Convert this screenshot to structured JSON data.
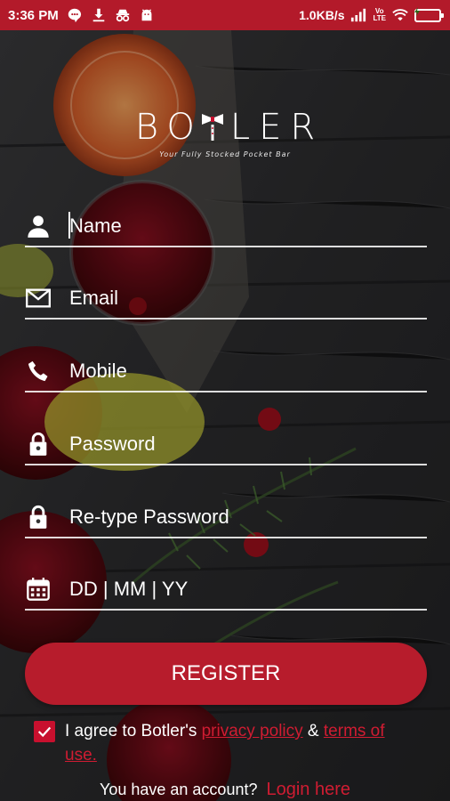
{
  "status_bar": {
    "time": "3:36 PM",
    "net_speed": "1.0KB/s",
    "volte_top": "Vo",
    "volte_bottom": "LTE",
    "left_icons": [
      "chat-bubble-icon",
      "download-icon",
      "incognito-icon",
      "android-icon"
    ],
    "right_icons": [
      "signal-icon",
      "volte-icon",
      "wifi-icon",
      "battery-charging-icon"
    ]
  },
  "brand": {
    "logo_text_left": "BO",
    "logo_text_right": "LER",
    "tagline": "Your Fully Stocked Pocket Bar"
  },
  "form": {
    "name_placeholder": "Name",
    "email_placeholder": "Email",
    "mobile_placeholder": "Mobile",
    "password_placeholder": "Password",
    "retype_placeholder": "Re-type Password",
    "dob_placeholder": "DD | MM | YY"
  },
  "actions": {
    "register_label": "REGISTER"
  },
  "agreement": {
    "prefix": "I agree to Botler's ",
    "privacy": "privacy policy",
    "amp": " & ",
    "terms": "terms of use.",
    "checked": true
  },
  "login": {
    "prompt": "You have an account?",
    "link": "Login here"
  },
  "colors": {
    "accent": "#b71c2c",
    "status_bar": "#b31a2a",
    "link": "#d01c32"
  }
}
